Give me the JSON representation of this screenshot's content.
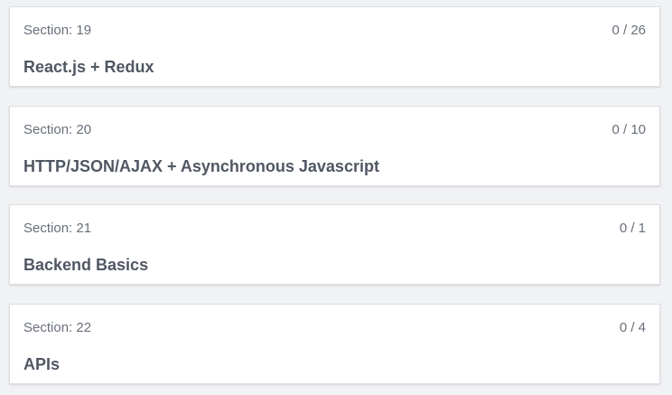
{
  "sections": [
    {
      "label": "Section: 19",
      "progress": "0 / 26",
      "title": "React.js + Redux"
    },
    {
      "label": "Section: 20",
      "progress": "0 / 10",
      "title": "HTTP/JSON/AJAX + Asynchronous Javascript"
    },
    {
      "label": "Section: 21",
      "progress": "0 / 1",
      "title": "Backend Basics"
    },
    {
      "label": "Section: 22",
      "progress": "0 / 4",
      "title": "APIs"
    }
  ]
}
